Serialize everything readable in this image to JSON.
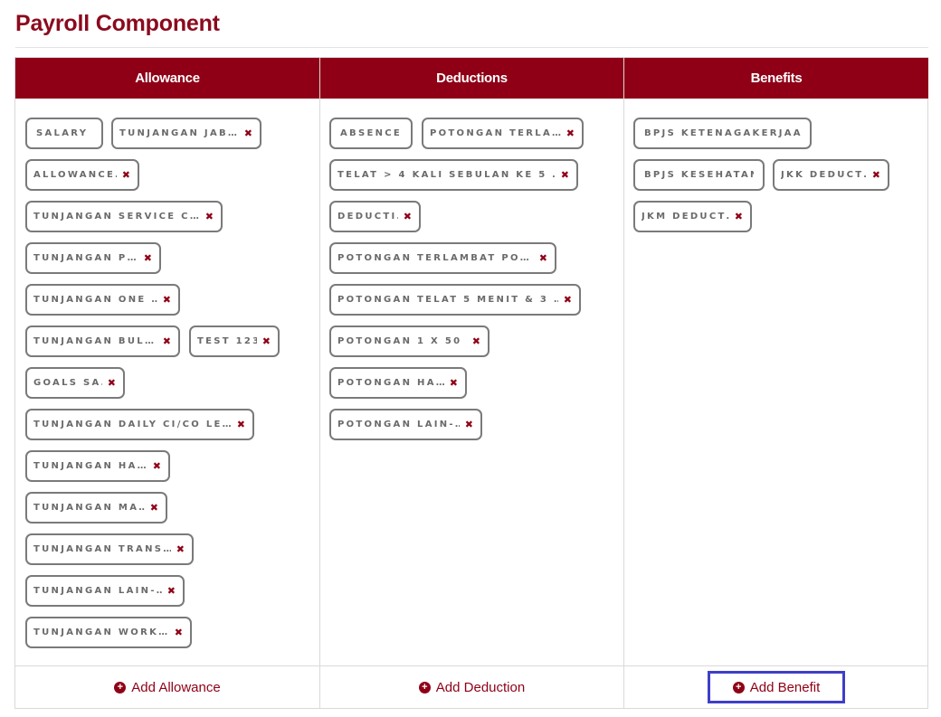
{
  "page": {
    "title": "Payroll Component"
  },
  "columns": {
    "allowance": {
      "header": "Allowance",
      "add_label": "Add Allowance",
      "chips": [
        {
          "text": "SALARY",
          "removable": false
        },
        {
          "text": "TUNJANGAN JAB…",
          "removable": true
        },
        {
          "text": "ALLOWANCE…",
          "removable": true
        },
        {
          "text": "TUNJANGAN SERVICE C…",
          "removable": true
        },
        {
          "text": "TUNJANGAN P…",
          "removable": true
        },
        {
          "text": "TUNJANGAN ONE …",
          "removable": true
        },
        {
          "text": "TUNJANGAN BUL…",
          "removable": true
        },
        {
          "text": "TEST 123",
          "removable": true
        },
        {
          "text": "GOALS SA…",
          "removable": true
        },
        {
          "text": "TUNJANGAN DAILY CI/CO LE…",
          "removable": true
        },
        {
          "text": "TUNJANGAN HA…",
          "removable": true
        },
        {
          "text": "TUNJANGAN MA…",
          "removable": true
        },
        {
          "text": "TUNJANGAN TRANS…",
          "removable": true
        },
        {
          "text": "TUNJANGAN LAIN-…",
          "removable": true
        },
        {
          "text": "TUNJANGAN WORK…",
          "removable": true
        }
      ]
    },
    "deductions": {
      "header": "Deductions",
      "add_label": "Add Deduction",
      "chips": [
        {
          "text": "ABSENCE",
          "removable": false
        },
        {
          "text": "POTONGAN TERLA…",
          "removable": true
        },
        {
          "text": "TELAT > 4 KALI SEBULAN KE 5 …",
          "removable": true
        },
        {
          "text": "DEDUCTI…",
          "removable": true
        },
        {
          "text": "POTONGAN TERLAMBAT PO…",
          "removable": true
        },
        {
          "text": "POTONGAN TELAT 5 MENIT & 3 …",
          "removable": true
        },
        {
          "text": "POTONGAN 1 X 50 …",
          "removable": true
        },
        {
          "text": "POTONGAN HA…",
          "removable": true
        },
        {
          "text": "POTONGAN LAIN-…",
          "removable": true
        }
      ]
    },
    "benefits": {
      "header": "Benefits",
      "add_label": "Add Benefit",
      "chips": [
        {
          "text": "BPJS KETENAGAKERJAAN",
          "removable": false
        },
        {
          "text": "BPJS KESEHATAN",
          "removable": false
        },
        {
          "text": "JKK DEDUCT…",
          "removable": true
        },
        {
          "text": "JKM DEDUCT…",
          "removable": true
        }
      ]
    }
  },
  "icons": {
    "remove": "close-icon",
    "add": "plus-circle-icon"
  },
  "colors": {
    "brand": "#8f0016",
    "chip_border": "#7a7a7a",
    "focus_ring": "#3f3fc8"
  }
}
